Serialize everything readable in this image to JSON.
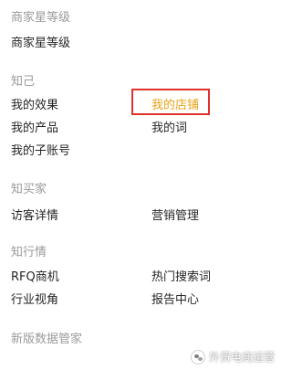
{
  "sections": [
    {
      "title": "商家星等级",
      "items": [
        "商家星等级"
      ]
    },
    {
      "title": "知己",
      "items": [
        "我的效果",
        "我的店铺",
        "我的产品",
        "我的词",
        "我的子账号"
      ]
    },
    {
      "title": "知买家",
      "items": [
        "访客详情",
        "营销管理"
      ]
    },
    {
      "title": "知行情",
      "items": [
        "RFQ商机",
        "热门搜索词",
        "行业视角",
        "报告中心"
      ]
    },
    {
      "title": "新版数据管家",
      "items": []
    }
  ],
  "highlight": {
    "color": "#e0312b",
    "text_color": "#e8a317"
  },
  "watermark": {
    "text": "外贸电商运营",
    "icon": "wechat-icon"
  }
}
